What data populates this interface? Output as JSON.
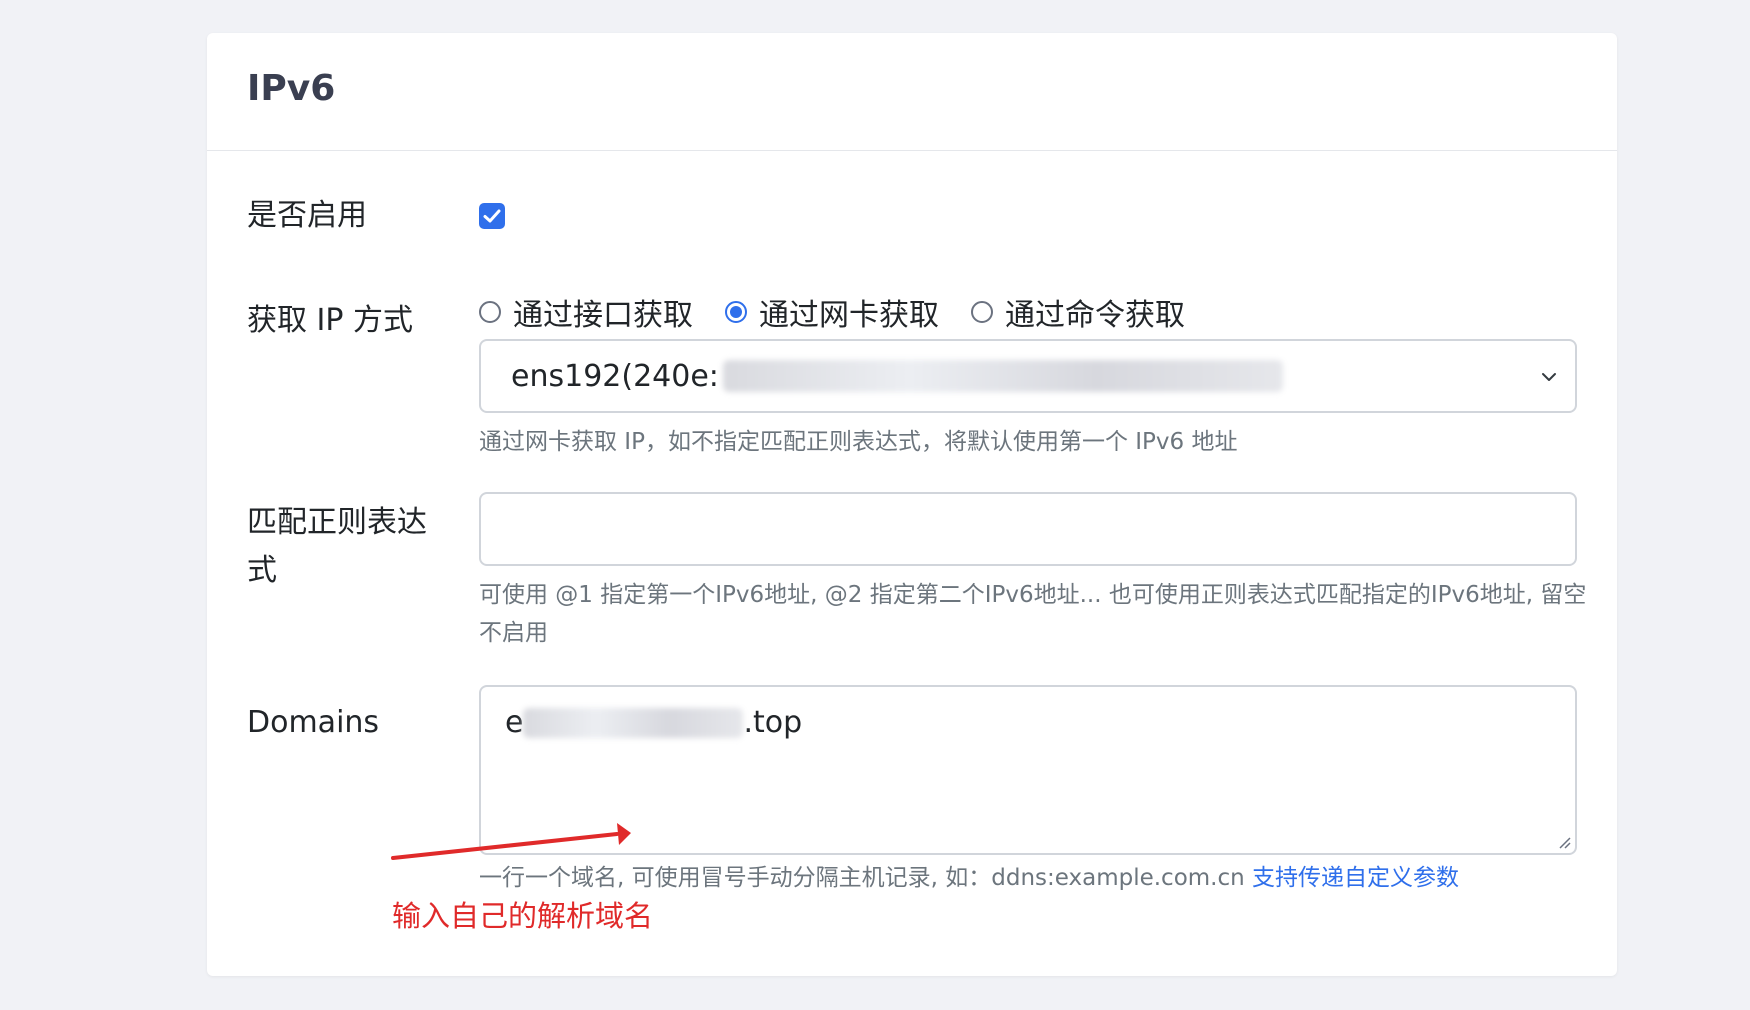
{
  "card": {
    "title": "IPv6"
  },
  "enable": {
    "label": "是否启用",
    "checked": true
  },
  "ip_method": {
    "label": "获取 IP 方式",
    "options": [
      "通过接口获取",
      "通过网卡获取",
      "通过命令获取"
    ],
    "selected": "通过网卡获取",
    "select_value": "ens192(240e:",
    "help": "通过网卡获取 IP，如不指定匹配正则表达式，将默认使用第一个 IPv6 地址"
  },
  "regex": {
    "label": "匹配正则表达式",
    "value": "",
    "help": "可使用 @1 指定第一个IPv6地址, @2 指定第二个IPv6地址... 也可使用正则表达式匹配指定的IPv6地址, 留空不启用"
  },
  "domains": {
    "label": "Domains",
    "value_prefix": "e",
    "value_suffix": ".top",
    "help": "一行一个域名, 可使用冒号手动分隔主机记录, 如：ddns:example.com.cn ",
    "help_link": "支持传递自定义参数"
  },
  "annotation": {
    "text": "输入自己的解析域名",
    "color": "#e02a2a"
  },
  "colors": {
    "accent": "#2f6feb",
    "background": "#f1f2f6"
  }
}
